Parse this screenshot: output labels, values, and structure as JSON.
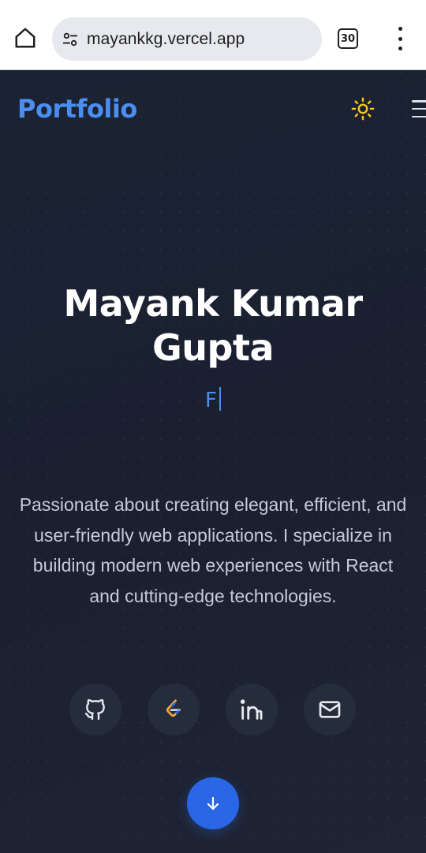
{
  "browser": {
    "url": "mayankkg.vercel.app",
    "tab_count": "30"
  },
  "header": {
    "brand": "Portfolio"
  },
  "hero": {
    "name": "Mayank Kumar Gupta",
    "typing_text": "F",
    "bio": "Passionate about creating elegant, efficient, and user-friendly web applications. I specialize in building modern web experiences with React and cutting-edge technologies."
  },
  "socials": [
    {
      "icon": "github-icon"
    },
    {
      "icon": "leetcode-icon"
    },
    {
      "icon": "linkedin-icon"
    },
    {
      "icon": "mail-icon"
    }
  ],
  "colors": {
    "accent": "#4a8ef0",
    "button_blue": "#2a67e6",
    "background": "#1a2030",
    "sun": "#f5c518"
  }
}
